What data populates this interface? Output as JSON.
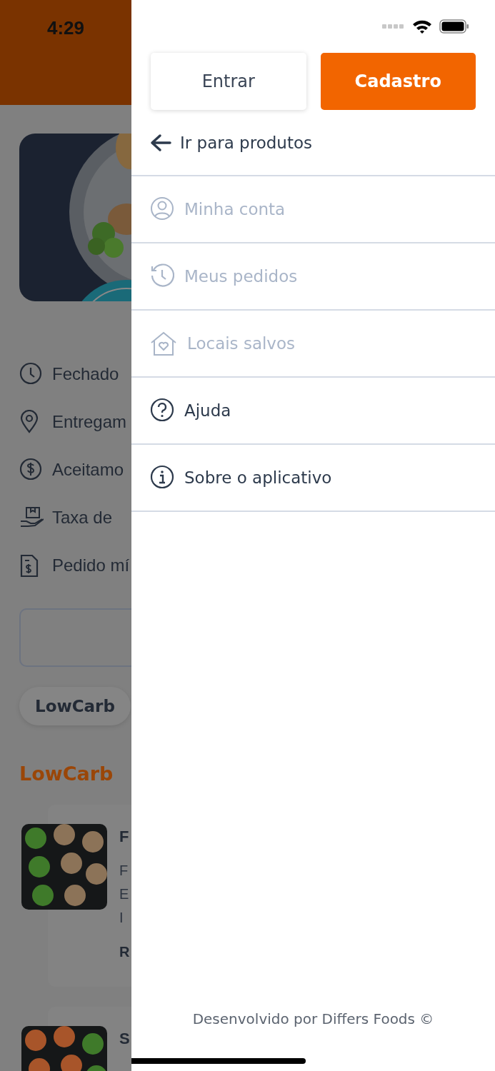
{
  "status_bar": {
    "time": "4:29"
  },
  "background": {
    "info_rows": [
      {
        "kind": "clock",
        "text": "Fechado"
      },
      {
        "kind": "pin",
        "text": "Entregam"
      },
      {
        "kind": "money",
        "text": "Aceitamo"
      },
      {
        "kind": "delivery",
        "text": "Taxa de"
      },
      {
        "kind": "receipt",
        "text": "Pedido mí"
      }
    ],
    "chips": [
      {
        "label": "LowCarb"
      }
    ],
    "section_title": "LowCarb",
    "products": [
      {
        "title": "F",
        "description": [
          "F",
          "E",
          "I"
        ],
        "price": "R"
      },
      {
        "title": "S"
      }
    ]
  },
  "drawer": {
    "buttons": [
      {
        "kind": "outline",
        "label": "Entrar"
      },
      {
        "kind": "primary",
        "label": "Cadastro"
      }
    ],
    "back_link": "Ir para produtos",
    "items": [
      {
        "kind": "user",
        "label": "Minha conta",
        "disabled": true
      },
      {
        "kind": "history",
        "label": "Meus pedidos",
        "disabled": true
      },
      {
        "kind": "home-heart",
        "label": "Locais salvos",
        "disabled": true
      },
      {
        "kind": "help",
        "label": "Ajuda",
        "disabled": false
      },
      {
        "kind": "info",
        "label": "Sobre o aplicativo",
        "disabled": false
      }
    ],
    "footer": "Desenvolvido por Differs Foods ©"
  }
}
